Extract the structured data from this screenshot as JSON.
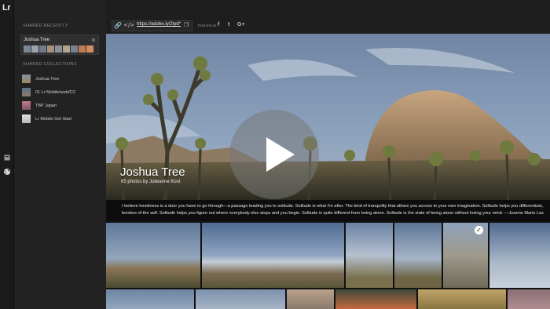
{
  "app": {
    "logo": "Lr"
  },
  "sidebar": {
    "recent_title": "SHARED RECENTLY",
    "recent_item": {
      "name": "Joshua Tree"
    },
    "collections_title": "SHARED COLLECTIONS",
    "collections": [
      {
        "label": "Joshua Tree",
        "color": "#8a7a5a"
      },
      {
        "label": "01 Lr Mobile/web/CC",
        "color": "#5d6f86"
      },
      {
        "label": "TBP Japan",
        "color": "#b9707a"
      },
      {
        "label": "Lr Mobile Get Start",
        "color": "#d8d8d8"
      }
    ]
  },
  "toolbar": {
    "link_icon": "link-icon",
    "embed_icon": "embed-icon",
    "url": "https://adobe.ly/2tyd*",
    "share_label": "Post link on:",
    "social": [
      "f",
      "t",
      "G+"
    ]
  },
  "hero": {
    "title": "Joshua Tree",
    "subtitle": "65 photos by Julieanne Kost"
  },
  "description": {
    "line1": "I believe loneliness is a door you have to go through—a passage leading you to solitude. Solitude is what I'm after. The kind of tranquility that allows you access to your own imagination. Solitude helps you differentiate,",
    "line2": "borders of the self. Solitude helps you figure out where everybody else stops and you begin. Solitude is quite different from being alone. Solitude is the state of being alone without losing your mind. —Jeanne Marie Las"
  },
  "colors": {
    "sidebar": "#222222",
    "toolbar": "#1e1e1e",
    "accent": "#ffffff"
  }
}
